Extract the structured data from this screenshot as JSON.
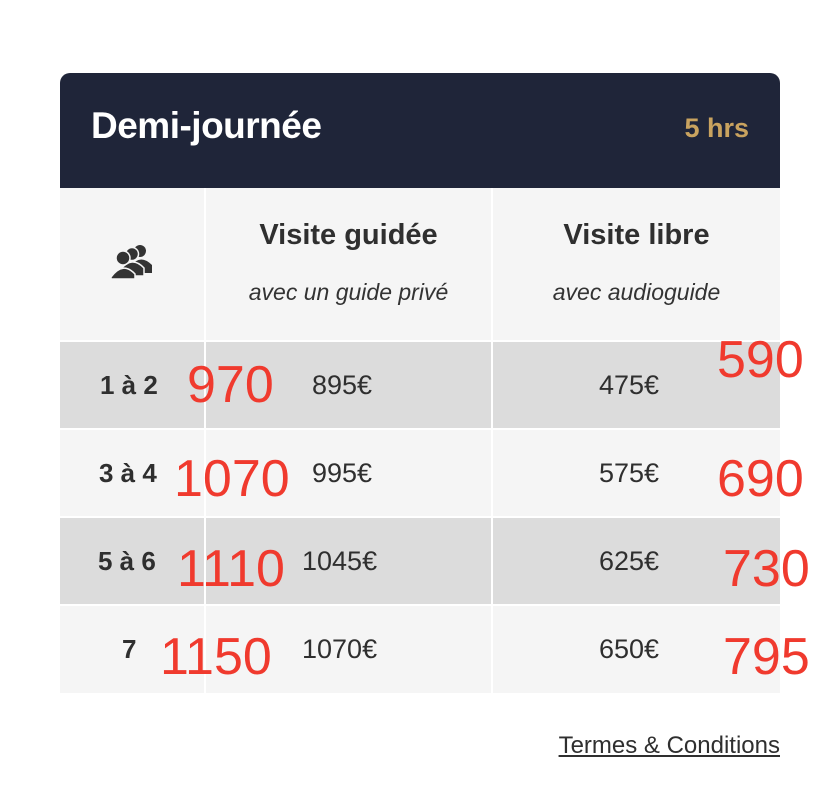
{
  "header": {
    "title": "Demi-journée",
    "duration": "5 hrs"
  },
  "columns": {
    "group_icon": "group-people-icon",
    "guided": {
      "title": "Visite guidée",
      "subtitle": "avec un guide privé"
    },
    "free": {
      "title": "Visite libre",
      "subtitle": "avec audioguide"
    }
  },
  "rows": [
    {
      "group": "1 à 2",
      "guided": "895€",
      "free": "475€"
    },
    {
      "group": "3 à 4",
      "guided": "995€",
      "free": "575€"
    },
    {
      "group": "5 à 6",
      "guided": "1045€",
      "free": "625€"
    },
    {
      "group": "7",
      "guided": "1070€",
      "free": "650€"
    }
  ],
  "annotations": {
    "guided": [
      "970",
      "1070",
      "1110",
      "1150"
    ],
    "free": [
      "590",
      "690",
      "730",
      "795"
    ]
  },
  "colors": {
    "header_bg": "#1f2539",
    "duration": "#c9a35f",
    "annotation": "#f03a2e",
    "row_dark": "#dcdcdc",
    "row_light": "#f5f5f5"
  },
  "footer": {
    "terms_label": "Termes & Conditions"
  }
}
